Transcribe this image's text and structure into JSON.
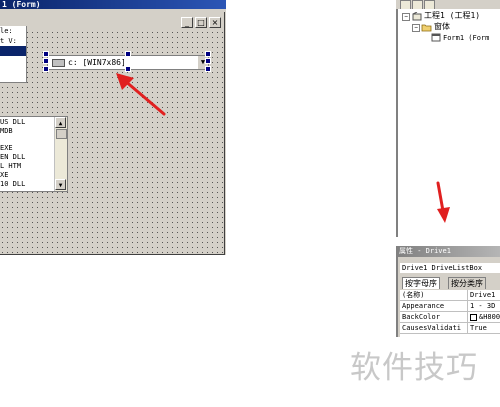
{
  "designer": {
    "title": "1 (Form)",
    "window_buttons": [
      "_",
      "□",
      "×"
    ]
  },
  "dirlist": {
    "items": [
      {
        "text": "le:",
        "selected": false
      },
      {
        "text": "t V:",
        "selected": false
      },
      {
        "text": "",
        "selected": true
      }
    ]
  },
  "filelist": {
    "items": [
      "US DLL",
      "MDB",
      "",
      "EXE",
      "EN DLL",
      "L HTM",
      "XE",
      "10 DLL"
    ],
    "scroll_up": "▲",
    "scroll_down": "▼"
  },
  "drive_combo": {
    "text": "c: [WIN7x86]",
    "dropdown_glyph": "▼"
  },
  "project": {
    "root_label": "工程1 (工程1)",
    "folder_label": "窗体",
    "form_label": "Form1 (Form"
  },
  "properties": {
    "title": "属性 - Drive1",
    "object_selector": "Drive1 DriveListBox",
    "tabs": [
      "按字母序",
      "按分类序"
    ],
    "rows": [
      {
        "name": "(名称)",
        "value": "Drive1"
      },
      {
        "name": "Appearance",
        "value": "1 - 3D"
      },
      {
        "name": "BackColor",
        "value": "&H8000"
      },
      {
        "name": "CausesValidati",
        "value": "True"
      }
    ]
  },
  "annotations": {
    "arrow_color": "#e02020"
  },
  "watermark": "软件技巧"
}
